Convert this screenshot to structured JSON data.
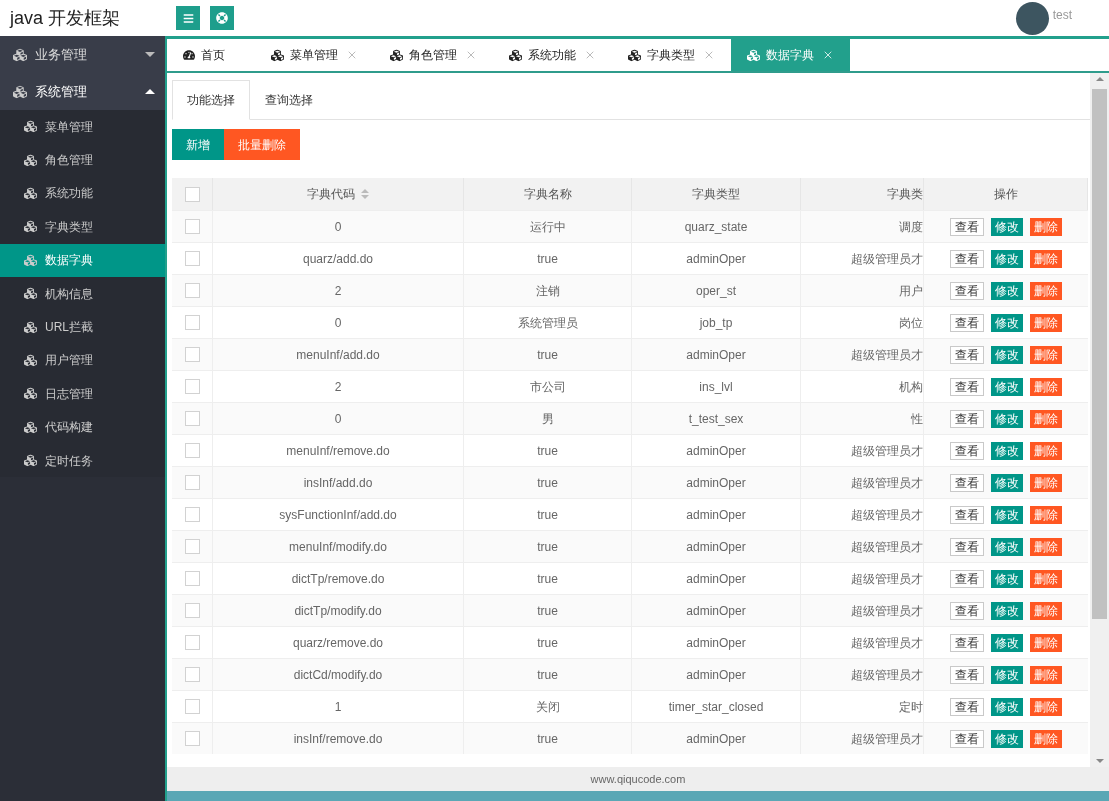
{
  "header": {
    "title": "java 开发框架",
    "user": "test"
  },
  "sidebar": [
    {
      "label": "业务管理",
      "expanded": false
    },
    {
      "label": "系统管理",
      "expanded": true,
      "children": [
        {
          "label": "菜单管理",
          "selected": false
        },
        {
          "label": "角色管理",
          "selected": false
        },
        {
          "label": "系统功能",
          "selected": false
        },
        {
          "label": "字典类型",
          "selected": false
        },
        {
          "label": "数据字典",
          "selected": true
        },
        {
          "label": "机构信息",
          "selected": false
        },
        {
          "label": "URL拦截",
          "selected": false
        },
        {
          "label": "用户管理",
          "selected": false
        },
        {
          "label": "日志管理",
          "selected": false
        },
        {
          "label": "代码构建",
          "selected": false
        },
        {
          "label": "定时任务",
          "selected": false
        }
      ]
    }
  ],
  "tabs": [
    {
      "label": "首页",
      "kind": "home",
      "closable": false,
      "selected": false
    },
    {
      "label": "菜单管理",
      "kind": "page",
      "closable": true,
      "selected": false
    },
    {
      "label": "角色管理",
      "kind": "page",
      "closable": true,
      "selected": false
    },
    {
      "label": "系统功能",
      "kind": "page",
      "closable": true,
      "selected": false
    },
    {
      "label": "字典类型",
      "kind": "page",
      "closable": true,
      "selected": false
    },
    {
      "label": "数据字典",
      "kind": "page",
      "closable": true,
      "selected": true
    }
  ],
  "subtabs": [
    {
      "label": "功能选择",
      "selected": true
    },
    {
      "label": "查询选择",
      "selected": false
    }
  ],
  "toolbar": [
    {
      "label": "新增",
      "kind": "primary"
    },
    {
      "label": "批量删除",
      "kind": "danger"
    }
  ],
  "table": {
    "select_all": {
      "checked": false
    },
    "columns": [
      {
        "label": "字典代码",
        "sortable": true
      },
      {
        "label": "字典名称",
        "sortable": false
      },
      {
        "label": "字典类型",
        "sortable": false
      },
      {
        "label": "字典类",
        "sortable": false
      },
      {
        "label": "操作",
        "sortable": false
      }
    ],
    "rows": [
      {
        "checked": false,
        "cells": [
          "0",
          "运行中",
          "quarz_state",
          "调度"
        ],
        "actions": [
          {
            "label": "查看",
            "kind": "view"
          },
          {
            "label": "修改",
            "kind": "edit"
          },
          {
            "label": "删除",
            "kind": "delete"
          }
        ]
      },
      {
        "checked": false,
        "cells": [
          "quarz/add.do",
          "true",
          "adminOper",
          "超级管理员才"
        ],
        "actions": [
          {
            "label": "查看",
            "kind": "view"
          },
          {
            "label": "修改",
            "kind": "edit"
          },
          {
            "label": "删除",
            "kind": "delete"
          }
        ]
      },
      {
        "checked": false,
        "cells": [
          "2",
          "注销",
          "oper_st",
          "用户"
        ],
        "actions": [
          {
            "label": "查看",
            "kind": "view"
          },
          {
            "label": "修改",
            "kind": "edit"
          },
          {
            "label": "删除",
            "kind": "delete"
          }
        ]
      },
      {
        "checked": false,
        "cells": [
          "0",
          "系统管理员",
          "job_tp",
          "岗位"
        ],
        "actions": [
          {
            "label": "查看",
            "kind": "view"
          },
          {
            "label": "修改",
            "kind": "edit"
          },
          {
            "label": "删除",
            "kind": "delete"
          }
        ]
      },
      {
        "checked": false,
        "cells": [
          "menuInf/add.do",
          "true",
          "adminOper",
          "超级管理员才"
        ],
        "actions": [
          {
            "label": "查看",
            "kind": "view"
          },
          {
            "label": "修改",
            "kind": "edit"
          },
          {
            "label": "删除",
            "kind": "delete"
          }
        ]
      },
      {
        "checked": false,
        "cells": [
          "2",
          "市公司",
          "ins_lvl",
          "机构"
        ],
        "actions": [
          {
            "label": "查看",
            "kind": "view"
          },
          {
            "label": "修改",
            "kind": "edit"
          },
          {
            "label": "删除",
            "kind": "delete"
          }
        ]
      },
      {
        "checked": false,
        "cells": [
          "0",
          "男",
          "t_test_sex",
          "性"
        ],
        "actions": [
          {
            "label": "查看",
            "kind": "view"
          },
          {
            "label": "修改",
            "kind": "edit"
          },
          {
            "label": "删除",
            "kind": "delete"
          }
        ]
      },
      {
        "checked": false,
        "cells": [
          "menuInf/remove.do",
          "true",
          "adminOper",
          "超级管理员才"
        ],
        "actions": [
          {
            "label": "查看",
            "kind": "view"
          },
          {
            "label": "修改",
            "kind": "edit"
          },
          {
            "label": "删除",
            "kind": "delete"
          }
        ]
      },
      {
        "checked": false,
        "cells": [
          "insInf/add.do",
          "true",
          "adminOper",
          "超级管理员才"
        ],
        "actions": [
          {
            "label": "查看",
            "kind": "view"
          },
          {
            "label": "修改",
            "kind": "edit"
          },
          {
            "label": "删除",
            "kind": "delete"
          }
        ]
      },
      {
        "checked": false,
        "cells": [
          "sysFunctionInf/add.do",
          "true",
          "adminOper",
          "超级管理员才"
        ],
        "actions": [
          {
            "label": "查看",
            "kind": "view"
          },
          {
            "label": "修改",
            "kind": "edit"
          },
          {
            "label": "删除",
            "kind": "delete"
          }
        ]
      },
      {
        "checked": false,
        "cells": [
          "menuInf/modify.do",
          "true",
          "adminOper",
          "超级管理员才"
        ],
        "actions": [
          {
            "label": "查看",
            "kind": "view"
          },
          {
            "label": "修改",
            "kind": "edit"
          },
          {
            "label": "删除",
            "kind": "delete"
          }
        ]
      },
      {
        "checked": false,
        "cells": [
          "dictTp/remove.do",
          "true",
          "adminOper",
          "超级管理员才"
        ],
        "actions": [
          {
            "label": "查看",
            "kind": "view"
          },
          {
            "label": "修改",
            "kind": "edit"
          },
          {
            "label": "删除",
            "kind": "delete"
          }
        ]
      },
      {
        "checked": false,
        "cells": [
          "dictTp/modify.do",
          "true",
          "adminOper",
          "超级管理员才"
        ],
        "actions": [
          {
            "label": "查看",
            "kind": "view"
          },
          {
            "label": "修改",
            "kind": "edit"
          },
          {
            "label": "删除",
            "kind": "delete"
          }
        ]
      },
      {
        "checked": false,
        "cells": [
          "quarz/remove.do",
          "true",
          "adminOper",
          "超级管理员才"
        ],
        "actions": [
          {
            "label": "查看",
            "kind": "view"
          },
          {
            "label": "修改",
            "kind": "edit"
          },
          {
            "label": "删除",
            "kind": "delete"
          }
        ]
      },
      {
        "checked": false,
        "cells": [
          "dictCd/modify.do",
          "true",
          "adminOper",
          "超级管理员才"
        ],
        "actions": [
          {
            "label": "查看",
            "kind": "view"
          },
          {
            "label": "修改",
            "kind": "edit"
          },
          {
            "label": "删除",
            "kind": "delete"
          }
        ]
      },
      {
        "checked": false,
        "cells": [
          "1",
          "关闭",
          "timer_star_closed",
          "定时"
        ],
        "actions": [
          {
            "label": "查看",
            "kind": "view"
          },
          {
            "label": "修改",
            "kind": "edit"
          },
          {
            "label": "删除",
            "kind": "delete"
          }
        ]
      },
      {
        "checked": false,
        "cells": [
          "insInf/remove.do",
          "true",
          "adminOper",
          "超级管理员才"
        ],
        "actions": [
          {
            "label": "查看",
            "kind": "view"
          },
          {
            "label": "修改",
            "kind": "edit"
          },
          {
            "label": "删除",
            "kind": "delete"
          }
        ]
      }
    ]
  },
  "footer": "www.qiqucode.com"
}
